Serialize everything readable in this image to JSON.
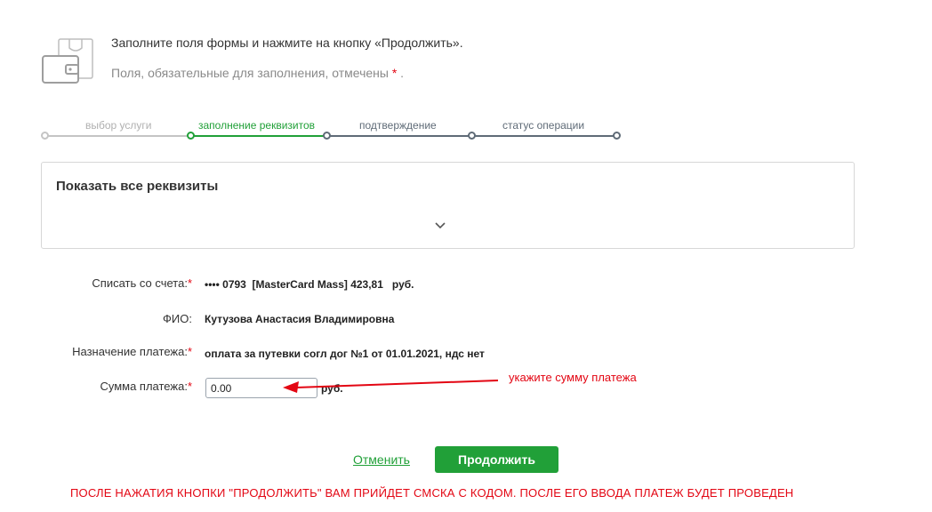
{
  "header": {
    "icon": "wallet-icon",
    "instruction": "Заполните поля формы и нажмите на кнопку «Продолжить».",
    "required_note": "Поля, обязательные для заполнения, отмечены",
    "required_mark": "*",
    "required_suffix": "."
  },
  "steps": [
    {
      "label": "выбор услуги",
      "state": "done"
    },
    {
      "label": "заполнение реквизитов",
      "state": "current"
    },
    {
      "label": "подтверждение",
      "state": "upcoming"
    },
    {
      "label": "статус операции",
      "state": "upcoming"
    }
  ],
  "details_panel": {
    "title": "Показать все реквизиты",
    "icon": "chevron-down-icon"
  },
  "form": {
    "account": {
      "label": "Списать со счета:",
      "required": "*",
      "value": "•••• 0793  [MasterCard Mass] 423,81   руб."
    },
    "name": {
      "label": "ФИО:",
      "value": "Кутузова Анастасия Владимировна"
    },
    "purpose": {
      "label": "Назначение платежа:",
      "required": "*",
      "value": "оплата за путевки согл дог №1 от 01.01.2021, ндс нет"
    },
    "amount": {
      "label": "Сумма платежа:",
      "required": "*",
      "value": "0.00",
      "currency": "руб."
    }
  },
  "annotation": {
    "text": "укажите сумму платежа",
    "icon": "arrow-left-icon"
  },
  "actions": {
    "cancel_label": "Отменить",
    "continue_label": "Продолжить"
  },
  "bottom_note": "ПОСЛЕ НАЖАТИЯ КНОПКИ \"ПРОДОЛЖИТЬ\" ВАМ ПРИЙДЕТ СМСКА С КОДОМ. ПОСЛЕ ЕГО ВВОДА ПЛАТЕЖ БУДЕТ ПРОВЕДЕН",
  "colors": {
    "brand_green": "#21a038",
    "step_done": "#c4c4c4",
    "step_upcoming": "#5f6b77",
    "annotation_red": "#e30613"
  }
}
